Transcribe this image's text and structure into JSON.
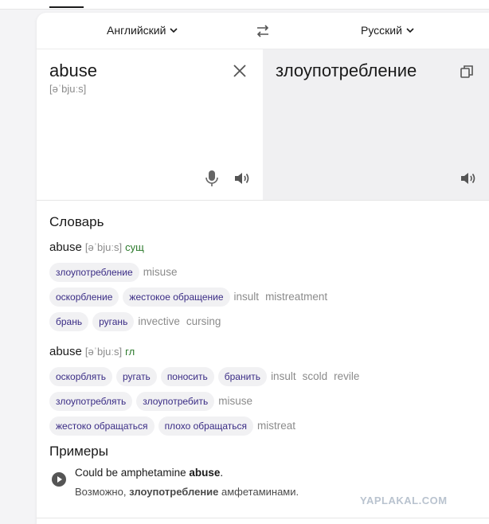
{
  "header": {
    "source_lang": "Английский",
    "target_lang": "Русский"
  },
  "source": {
    "word": "abuse",
    "transcription": "[əˈbjuːs]"
  },
  "target": {
    "word": "злоупотребление"
  },
  "dictionary": {
    "title": "Словарь",
    "entries": [
      {
        "headword": "abuse",
        "transcription": "[əˈbjuːs]",
        "pos": "сущ",
        "rows": [
          {
            "chips": [
              "злоупотребление"
            ],
            "synonyms": [
              "misuse"
            ]
          },
          {
            "chips": [
              "оскорбление",
              "жестокое обращение"
            ],
            "synonyms": [
              "insult",
              "mistreatment"
            ]
          },
          {
            "chips": [
              "брань",
              "ругань"
            ],
            "synonyms": [
              "invective",
              "cursing"
            ]
          }
        ]
      },
      {
        "headword": "abuse",
        "transcription": "[əˈbjuːs]",
        "pos": "гл",
        "rows": [
          {
            "chips": [
              "оскорблять",
              "ругать",
              "поносить",
              "бранить"
            ],
            "synonyms": [
              "insult",
              "scold",
              "revile"
            ]
          },
          {
            "chips": [
              "злоупотреблять",
              "злоупотребить"
            ],
            "synonyms": [
              "misuse"
            ]
          },
          {
            "chips": [
              "жестоко обращаться",
              "плохо обращаться"
            ],
            "synonyms": [
              "mistreat"
            ]
          }
        ]
      }
    ]
  },
  "examples": {
    "title": "Примеры",
    "items": [
      {
        "src_before": "Could be amphetamine ",
        "src_bold": "abuse",
        "src_after": ".",
        "tgt_before": "Возможно, ",
        "tgt_bold": "злоупотребление",
        "tgt_after": " амфетаминами."
      }
    ]
  },
  "watermark": "YAPLAKAL.COM",
  "colors": {
    "chip_text": "#3a2c85",
    "pos": "#2c7a2c",
    "muted": "#8b8b8b",
    "target_pane_bg": "#f0f0f2"
  }
}
